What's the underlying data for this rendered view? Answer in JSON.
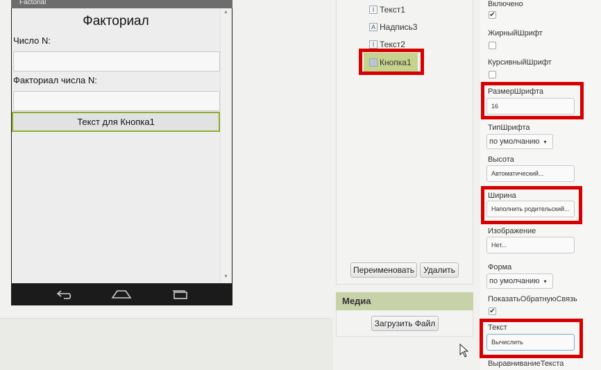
{
  "viewer": {
    "window_title": "Factorial",
    "app_title": "Факториал",
    "label_n": "Число N:",
    "label_result": "Факториал числа N:",
    "button_text": "Текст для Кнопка1"
  },
  "components": {
    "items": [
      {
        "name": "Текст1",
        "icon": "textbox-icon"
      },
      {
        "name": "Надпись3",
        "icon": "label-icon"
      },
      {
        "name": "Текст2",
        "icon": "textbox-icon"
      },
      {
        "name": "Кнопка1",
        "icon": "button-icon",
        "selected": true
      }
    ],
    "rename_label": "Переименовать",
    "delete_label": "Удалить"
  },
  "media": {
    "header": "Медиа",
    "upload_label": "Загрузить Файл"
  },
  "properties": {
    "enabled_label": "Включено",
    "enabled": true,
    "bold_label": "ЖирныйШрифт",
    "bold": false,
    "italic_label": "КурсивныйШрифт",
    "italic": false,
    "font_size_label": "РазмерШрифта",
    "font_size": "16",
    "font_type_label": "ТипШрифта",
    "font_type": "по умолчанию",
    "height_label": "Высота",
    "height": "Автоматический...",
    "width_label": "Ширина",
    "width": "Наполнить родительский...",
    "image_label": "Изображение",
    "image": "Нет...",
    "shape_label": "Форма",
    "shape": "по умолчанию",
    "show_feedback_label": "ПоказатьОбратнуюСвязь",
    "show_feedback": true,
    "text_label": "Текст",
    "text": "Вычислить",
    "text_align_label": "ВыравниваниеТекста"
  },
  "colors": {
    "highlight": "#d50000",
    "selection": "#c5d38d",
    "button_border": "#8dad2c"
  }
}
